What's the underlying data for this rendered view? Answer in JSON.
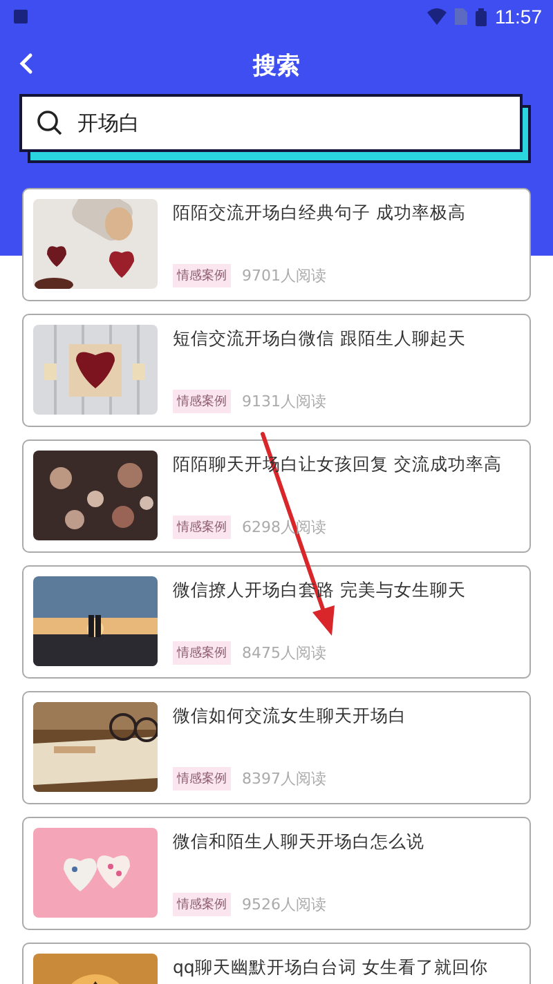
{
  "status_bar": {
    "time": "11:57"
  },
  "header": {
    "title": "搜索"
  },
  "search": {
    "value": "开场白"
  },
  "results": [
    {
      "title": "陌陌交流开场白经典句子 成功率极高",
      "tag": "情感案例",
      "reads": "9701人阅读",
      "kind": "picture"
    },
    {
      "title": "短信交流开场白微信 跟陌生人聊起天",
      "tag": "情感案例",
      "reads": "9131人阅读",
      "kind": "picture"
    },
    {
      "title": "陌陌聊天开场白让女孩回复 交流成功率高",
      "tag": "情感案例",
      "reads": "6298人阅读",
      "kind": "picture"
    },
    {
      "title": "微信撩人开场白套路 完美与女生聊天",
      "tag": "情感案例",
      "reads": "8475人阅读",
      "kind": "picture"
    },
    {
      "title": "微信如何交流女生聊天开场白",
      "tag": "情感案例",
      "reads": "8397人阅读",
      "kind": "picture"
    },
    {
      "title": "微信和陌生人聊天开场白怎么说",
      "tag": "情感案例",
      "reads": "9526人阅读",
      "kind": "picture"
    },
    {
      "title": "qq聊天幽默开场白台词 女生看了就回你",
      "kind": "picture"
    }
  ]
}
